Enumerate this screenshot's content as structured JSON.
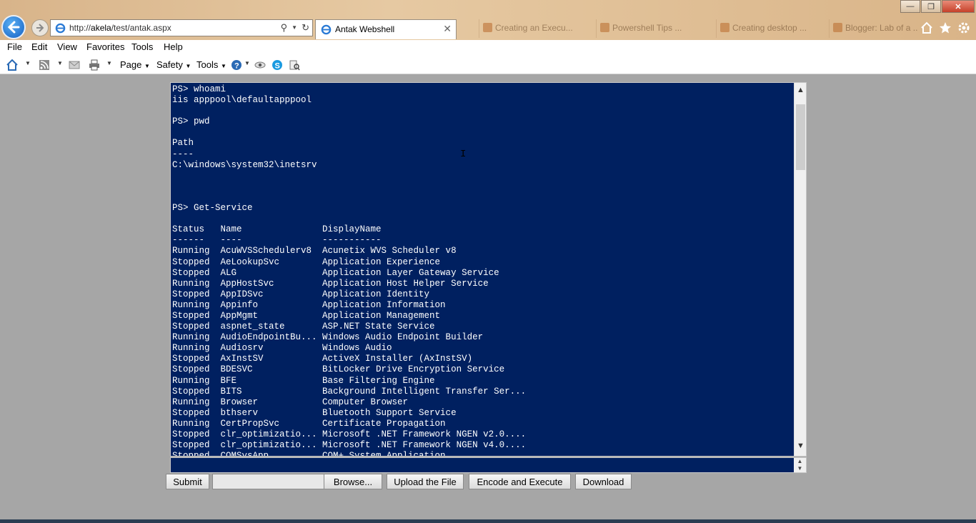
{
  "browser": {
    "url_prefix": "http://",
    "url_domain": "akela",
    "url_path": "/test/antak.aspx",
    "active_tab_title": "Antak Webshell",
    "background_tabs": [
      "Creating an Execu...",
      "Powershell Tips ...",
      "Creating desktop ...",
      "Blogger: Lab of a ..."
    ]
  },
  "menu": [
    "File",
    "Edit",
    "View",
    "Favorites",
    "Tools",
    "Help"
  ],
  "commandbar": {
    "page_label": "Page",
    "safety_label": "Safety",
    "tools_label": "Tools"
  },
  "console": {
    "lines": [
      "PS> whoami",
      "iis apppool\\defaultapppool",
      "",
      "PS> pwd",
      "",
      "Path",
      "----",
      "C:\\windows\\system32\\inetsrv",
      "",
      "",
      "",
      "PS> Get-Service",
      "",
      "Status   Name               DisplayName",
      "------   ----               -----------",
      "Running  AcuWVSSchedulerv8  Acunetix WVS Scheduler v8",
      "Stopped  AeLookupSvc        Application Experience",
      "Stopped  ALG                Application Layer Gateway Service",
      "Running  AppHostSvc         Application Host Helper Service",
      "Stopped  AppIDSvc           Application Identity",
      "Running  Appinfo            Application Information",
      "Stopped  AppMgmt            Application Management",
      "Stopped  aspnet_state       ASP.NET State Service",
      "Running  AudioEndpointBu... Windows Audio Endpoint Builder",
      "Running  Audiosrv           Windows Audio",
      "Stopped  AxInstSV           ActiveX Installer (AxInstSV)",
      "Stopped  BDESVC             BitLocker Drive Encryption Service",
      "Running  BFE                Base Filtering Engine",
      "Stopped  BITS               Background Intelligent Transfer Ser...",
      "Running  Browser            Computer Browser",
      "Stopped  bthserv            Bluetooth Support Service",
      "Running  CertPropSvc        Certificate Propagation",
      "Stopped  clr_optimizatio... Microsoft .NET Framework NGEN v2.0....",
      "Stopped  clr_optimizatio... Microsoft .NET Framework NGEN v4.0....",
      "Stopped  COMSysApp          COM+ System Application"
    ],
    "command_value": ""
  },
  "buttons": {
    "submit": "Submit",
    "browse": "Browse...",
    "upload": "Upload the File",
    "encode": "Encode and Execute",
    "download": "Download"
  }
}
